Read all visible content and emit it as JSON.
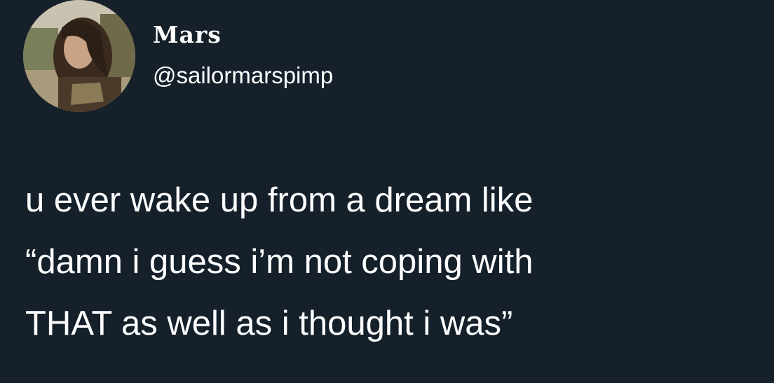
{
  "author": {
    "display_name": "Mars",
    "handle": "@sailormarspimp",
    "avatar_icon": "profile-photo-icon"
  },
  "tweet": {
    "text": "u ever wake up from a dream like\n“damn i guess i’m not coping with\nTHAT as well as i thought i was”"
  },
  "colors": {
    "background": "#15202b",
    "text": "#ffffff"
  }
}
